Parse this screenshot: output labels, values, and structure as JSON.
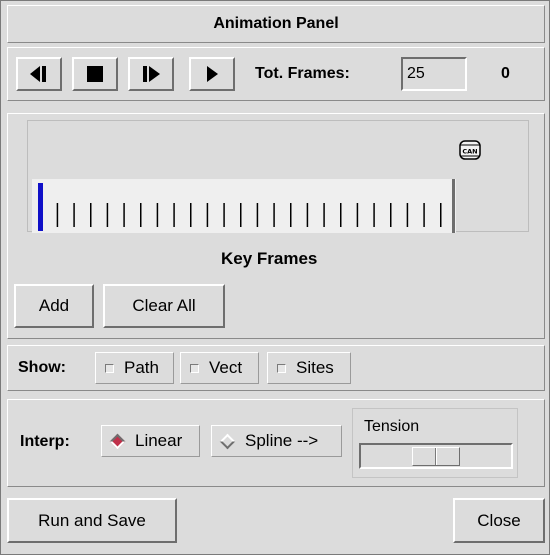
{
  "window": {
    "title": "Animation Panel"
  },
  "controls": {
    "step_back_icon": "step-backward-icon",
    "stop_icon": "stop-icon",
    "step_forward_icon": "step-forward-icon",
    "play_icon": "play-icon",
    "total_frames_label": "Tot. Frames:",
    "total_frames_value": "25",
    "current_frame": "0"
  },
  "keyframes": {
    "label": "Key Frames",
    "can_icon": "CAN",
    "tick_count": 25,
    "current_index": 0,
    "add_label": "Add",
    "clear_all_label": "Clear All"
  },
  "show": {
    "label": "Show:",
    "options": [
      {
        "label": "Path",
        "checked": false
      },
      {
        "label": "Vect",
        "checked": false
      },
      {
        "label": "Sites",
        "checked": false
      }
    ]
  },
  "interp": {
    "label": "Interp:",
    "linear_label": "Linear",
    "spline_label": "Spline -->",
    "selected": "Linear",
    "tension_label": "Tension",
    "tension_value": 0.5
  },
  "footer": {
    "run_save_label": "Run and Save",
    "close_label": "Close"
  },
  "colors": {
    "background": "#dcdcdc",
    "current_frame_marker": "#1010c8",
    "radio_selected": "#c0304a"
  }
}
